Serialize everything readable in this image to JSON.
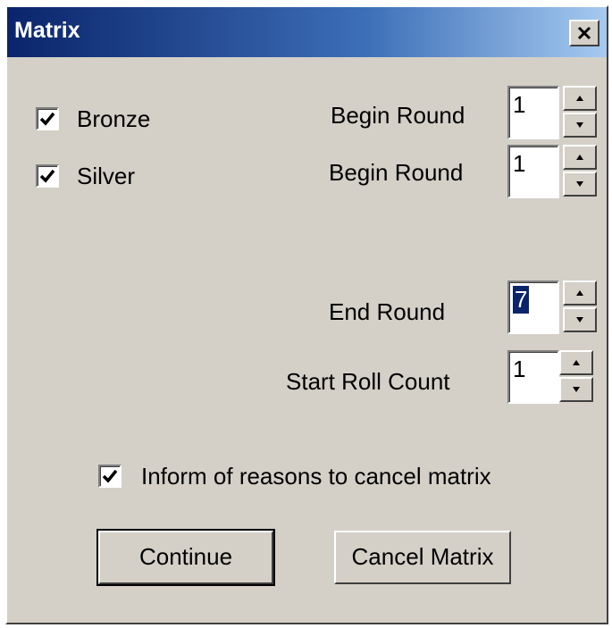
{
  "window": {
    "title": "Matrix",
    "close_label": "✕"
  },
  "checkboxes": {
    "bronze": {
      "label": "Bronze",
      "checked": true
    },
    "silver": {
      "label": "Silver",
      "checked": true
    },
    "inform": {
      "label": "Inform of reasons to cancel matrix",
      "checked": true
    }
  },
  "fields": {
    "bronze_begin": {
      "label": "Begin Round",
      "value": "1"
    },
    "silver_begin": {
      "label": "Begin Round",
      "value": "1"
    },
    "end_round": {
      "label": "End Round",
      "value": "7"
    },
    "start_roll": {
      "label": "Start Roll Count",
      "value": "1"
    }
  },
  "buttons": {
    "continue": "Continue",
    "cancel_matrix": "Cancel Matrix"
  }
}
